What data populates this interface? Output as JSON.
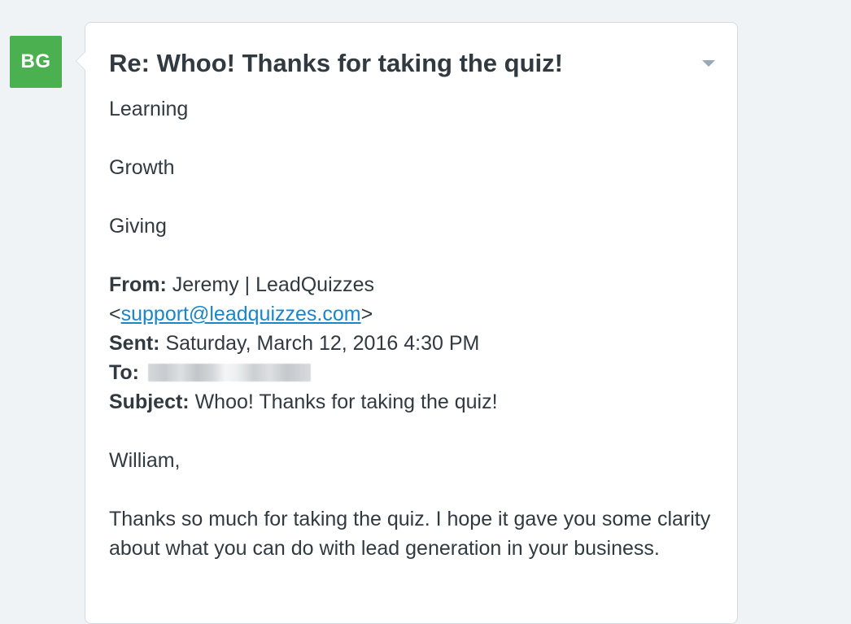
{
  "avatar": {
    "initials": "BG",
    "color": "#4bb050"
  },
  "message": {
    "subject": "Re: Whoo! Thanks for taking the quiz!",
    "menu_icon": "chevron-down-icon",
    "lines": {
      "l1": "Learning",
      "l2": "Growth",
      "l3": "Giving"
    },
    "quoted_header": {
      "from_label": "From:",
      "from_name": "Jeremy | LeadQuizzes",
      "from_email": "support@leadquizzes.com",
      "sent_label": "Sent:",
      "sent_value": "Saturday, March 12, 2016 4:30 PM",
      "to_label": "To:",
      "subject_label": "Subject:",
      "subject_value": "Whoo! Thanks for taking the quiz!"
    },
    "greeting": "William,",
    "paragraph": "Thanks so much for taking the quiz. I hope it gave you some clarity about what you can do with lead generation in your business."
  },
  "colors": {
    "background": "#f0f3f6",
    "link": "#1a86c8",
    "text": "#313a40"
  }
}
